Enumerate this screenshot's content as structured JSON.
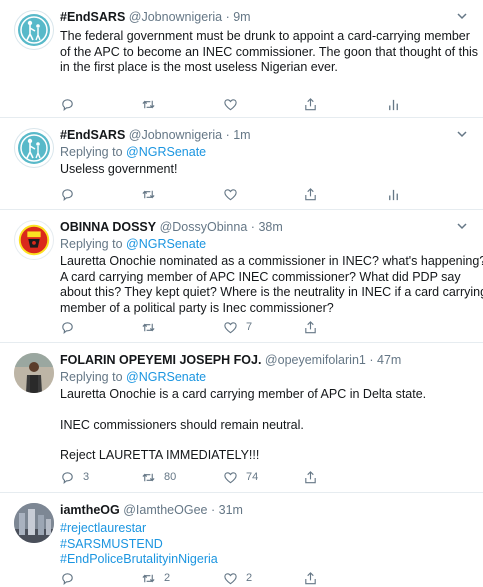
{
  "tweets": [
    {
      "name": "#EndSARS",
      "handle": "@Jobnownigeria",
      "sep": "·",
      "time": "9m",
      "replying_label": "",
      "replying_to": "",
      "lines": [
        "The federal government must be drunk to appoint a card-carrying member",
        "of the APC to become an INEC commissioner. The goon that thought of this",
        "in the first place is the most useless Nigerian ever."
      ],
      "counts": {
        "replies": "",
        "retweets": "",
        "likes": ""
      },
      "avatar": "endsars-logo"
    },
    {
      "name": "#EndSARS",
      "handle": "@Jobnownigeria",
      "sep": "·",
      "time": "1m",
      "replying_label": "Replying to",
      "replying_to": "@NGRSenate",
      "lines": [
        "Useless government!"
      ],
      "counts": {
        "replies": "",
        "retweets": "",
        "likes": ""
      },
      "avatar": "endsars-logo"
    },
    {
      "name": "OBINNA DOSSY",
      "handle": "@DossyObinna",
      "sep": "·",
      "time": "38m",
      "replying_label": "Replying to",
      "replying_to": "@NGRSenate",
      "lines": [
        "Lauretta Onochie nominated as a commissioner in INEC? what's happening?",
        "A card carrying member of APC INEC commissioner? What did PDP  say",
        "about this? They kept quiet? Where is the neutrality in INEC if a card carrying",
        "member of a political party is Inec commissioner?"
      ],
      "counts": {
        "replies": "",
        "retweets": "",
        "likes": "7"
      },
      "avatar": "man-utd-crest"
    },
    {
      "name": "FOLARIN OPEYEMI JOSEPH FOJ.",
      "handle": "@opeyemifolarin1",
      "sep": "·",
      "time": "47m",
      "replying_label": "Replying to",
      "replying_to": "@NGRSenate",
      "lines": [
        "Lauretta Onochie is a card carrying member of APC in Delta state.",
        "",
        "INEC commissioners should remain neutral.",
        "",
        "Reject LAURETTA IMMEDIATELY!!!"
      ],
      "counts": {
        "replies": "3",
        "retweets": "80",
        "likes": "74"
      },
      "avatar": "person-photo"
    },
    {
      "name": "iamtheOG",
      "handle": "@IamtheOGee",
      "sep": "·",
      "time": "31m",
      "replying_label": "",
      "replying_to": "",
      "lines": [
        "#rejectlaurestar",
        "#SARSMUSTEND",
        "#EndPoliceBrutalityinNigeria"
      ],
      "counts": {
        "replies": "",
        "retweets": "2",
        "likes": "2"
      },
      "avatar": "city-photo"
    }
  ],
  "colors": {
    "link": "#1b95e0",
    "muted": "#657786",
    "text": "#14171a",
    "retweet_active": "#17bf63",
    "divider": "#e6ecf0"
  }
}
